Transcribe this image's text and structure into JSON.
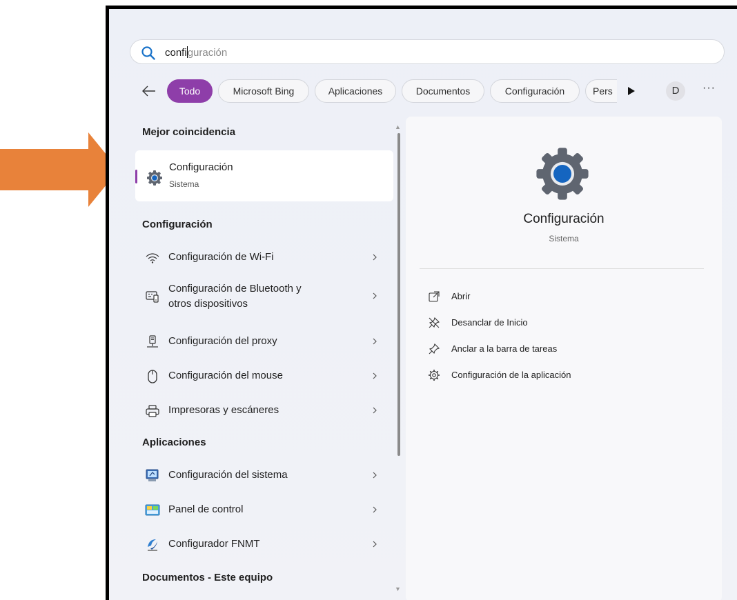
{
  "search": {
    "typed": "confi",
    "hint": "guración"
  },
  "filters": {
    "chips": [
      "Todo",
      "Microsoft Bing",
      "Aplicaciones",
      "Documentos",
      "Configuración",
      "Pers"
    ],
    "active": "Todo",
    "avatar_initial": "D",
    "more": "···"
  },
  "results": {
    "best_match_header": "Mejor coincidencia",
    "best_match": {
      "title": "Configuración",
      "subtitle": "Sistema"
    },
    "settings_header": "Configuración",
    "settings_items": [
      {
        "label": "Configuración de Wi-Fi",
        "icon": "wifi-icon"
      },
      {
        "label": "Configuración de Bluetooth y otros dispositivos",
        "line1": "Configuración de Bluetooth y",
        "line2": "otros dispositivos",
        "icon": "bluetooth-devices-icon"
      },
      {
        "label": "Configuración del proxy",
        "icon": "proxy-icon"
      },
      {
        "label": "Configuración del mouse",
        "icon": "mouse-icon"
      },
      {
        "label": "Impresoras y escáneres",
        "icon": "printer-icon"
      }
    ],
    "apps_header": "Aplicaciones",
    "apps_items": [
      {
        "label": "Configuración del sistema",
        "icon": "system-config-icon"
      },
      {
        "label": "Panel de control",
        "icon": "control-panel-icon"
      },
      {
        "label": "Configurador FNMT",
        "icon": "fnmt-icon"
      }
    ],
    "documents_header": "Documentos - Este equipo"
  },
  "detail": {
    "title": "Configuración",
    "subtitle": "Sistema",
    "actions": [
      {
        "label": "Abrir",
        "icon": "open-icon"
      },
      {
        "label": "Desanclar de Inicio",
        "icon": "unpin-icon"
      },
      {
        "label": "Anclar a la barra de tareas",
        "icon": "pin-icon"
      },
      {
        "label": "Configuración de la aplicación",
        "icon": "app-settings-icon"
      }
    ]
  },
  "colors": {
    "accent": "#8e3ea9",
    "arrow": "#e8823a",
    "gear_blue": "#1565c0",
    "gear_grey": "#5f6570"
  }
}
